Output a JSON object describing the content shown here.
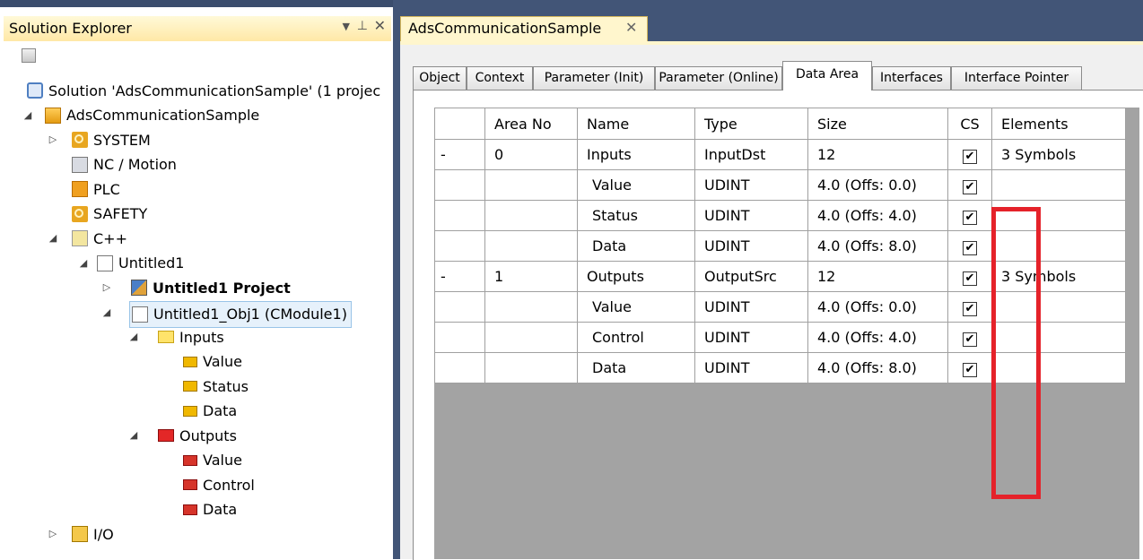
{
  "solution_explorer": {
    "title": "Solution Explorer",
    "pin_dropdown_glyph": "▼",
    "pin_glyph": "⊥",
    "close_glyph": "✕",
    "tree": [
      {
        "label": "Solution 'AdsCommunicationSample' (1 projec",
        "icon": "solution-icon",
        "expander": ""
      },
      {
        "label": "AdsCommunicationSample",
        "icon": "project-icon",
        "expander": "◢"
      },
      {
        "label": "SYSTEM",
        "icon": "system-icon",
        "expander": "▷"
      },
      {
        "label": "NC / Motion",
        "icon": "nc-motion-icon",
        "expander": ""
      },
      {
        "label": "PLC",
        "icon": "plc-icon",
        "expander": ""
      },
      {
        "label": "SAFETY",
        "icon": "safety-icon",
        "expander": ""
      },
      {
        "label": "C++",
        "icon": "cpp-icon",
        "expander": "◢"
      },
      {
        "label": "Untitled1",
        "icon": "cpp-module-icon",
        "expander": "◢"
      },
      {
        "label": "Untitled1 Project",
        "icon": "cpp-project-icon",
        "expander": "▷"
      },
      {
        "label": "Untitled1_Obj1 (CModule1)",
        "icon": "cpp-object-icon",
        "expander": "◢"
      },
      {
        "label": "Inputs",
        "icon": "inputs-folder-icon",
        "expander": "◢"
      },
      {
        "label": "Value",
        "icon": "input-variable-icon",
        "expander": ""
      },
      {
        "label": "Status",
        "icon": "input-variable-icon",
        "expander": ""
      },
      {
        "label": "Data",
        "icon": "input-variable-icon",
        "expander": ""
      },
      {
        "label": "Outputs",
        "icon": "outputs-folder-icon",
        "expander": "◢"
      },
      {
        "label": "Value",
        "icon": "output-variable-icon",
        "expander": ""
      },
      {
        "label": "Control",
        "icon": "output-variable-icon",
        "expander": ""
      },
      {
        "label": "Data",
        "icon": "output-variable-icon",
        "expander": ""
      },
      {
        "label": "I/O",
        "icon": "io-icon",
        "expander": "▷"
      }
    ]
  },
  "document": {
    "tab_title": "AdsCommunicationSample",
    "tab_close": "✕",
    "property_tabs": [
      "Object",
      "Context",
      "Parameter (Init)",
      "Parameter (Online)",
      "Data Area",
      "Interfaces",
      "Interface Pointer"
    ],
    "active_tab": "Data Area",
    "grid": {
      "columns": [
        "",
        "Area No",
        "Name",
        "Type",
        "Size",
        "CS",
        "Elements"
      ],
      "rows": [
        {
          "expander": "-",
          "area_no": "0",
          "name": "Inputs",
          "type": "InputDst",
          "size": "12",
          "cs": "✔",
          "elements": "3 Symbols"
        },
        {
          "expander": "",
          "area_no": "",
          "name": "Value",
          "type": "UDINT",
          "size": "4.0 (Offs: 0.0)",
          "cs": "✔",
          "elements": ""
        },
        {
          "expander": "",
          "area_no": "",
          "name": "Status",
          "type": "UDINT",
          "size": "4.0 (Offs: 4.0)",
          "cs": "✔",
          "elements": ""
        },
        {
          "expander": "",
          "area_no": "",
          "name": "Data",
          "type": "UDINT",
          "size": "4.0 (Offs: 8.0)",
          "cs": "✔",
          "elements": ""
        },
        {
          "expander": "-",
          "area_no": "1",
          "name": "Outputs",
          "type": "OutputSrc",
          "size": "12",
          "cs": "✔",
          "elements": "3 Symbols"
        },
        {
          "expander": "",
          "area_no": "",
          "name": "Value",
          "type": "UDINT",
          "size": "4.0 (Offs: 0.0)",
          "cs": "✔",
          "elements": ""
        },
        {
          "expander": "",
          "area_no": "",
          "name": "Control",
          "type": "UDINT",
          "size": "4.0 (Offs: 4.0)",
          "cs": "✔",
          "elements": ""
        },
        {
          "expander": "",
          "area_no": "",
          "name": "Data",
          "type": "UDINT",
          "size": "4.0 (Offs: 8.0)",
          "cs": "✔",
          "elements": ""
        }
      ]
    },
    "highlight_color": "#e5222a"
  },
  "colors": {
    "dark_frame": "#425577",
    "title_gold": "#ffe8a6",
    "selection": "#e6f1fb"
  }
}
